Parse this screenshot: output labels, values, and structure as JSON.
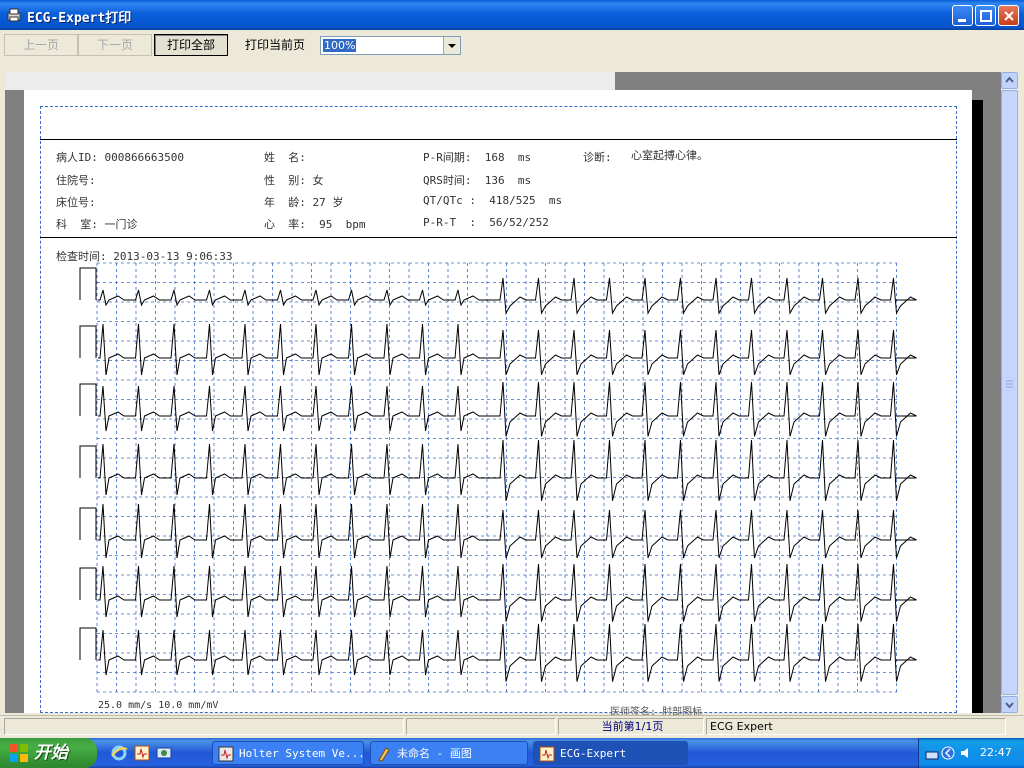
{
  "window": {
    "title": "ECG-Expert打印",
    "controls": [
      "minimize-icon",
      "maximize-icon",
      "close-icon"
    ]
  },
  "toolbar": {
    "prev_page": "上一页",
    "next_page": "下一页",
    "print_all": "打印全部",
    "print_current": "打印当前页",
    "zoom": "100%"
  },
  "report": {
    "patient_id": "病人ID: 000866663500",
    "inpatient_no": "住院号:",
    "bed_no": "床位号:",
    "department": "科  室: 一门诊",
    "name": "姓  名:",
    "sex": "性  别: 女",
    "age": "年  龄: 27 岁",
    "heart_rate": "心  率:  95  bpm",
    "pr_interval": "P-R间期:  168  ms",
    "qrs_time": "QRS时间:  136  ms",
    "qt_qtc": "QT/QTc :  418/525  ms",
    "prt": "P-R-T  :  56/52/252",
    "diagnosis_label": "诊断:",
    "diagnosis": "心室起搏心律。",
    "exam_time": "检查时间: 2013-03-13 9:06:33",
    "calibration": "25.0 mm/s 10.0 mm/mV",
    "footer_text": "医师签名: 肘部图标"
  },
  "statusbar": {
    "page_info": "当前第1/1页",
    "app_name": "ECG Expert"
  },
  "taskbar": {
    "start": "开始",
    "tasks": [
      "Holter System Ve...",
      "未命名 - 画图",
      "ECG-Expert"
    ],
    "clock": "22:47"
  },
  "colors": {
    "titlebar": "#0a5fd8",
    "grid": "#3a6cc8",
    "trace": "#000000",
    "taskbar": "#2157d7",
    "start_button": "#3c9c3c"
  }
}
